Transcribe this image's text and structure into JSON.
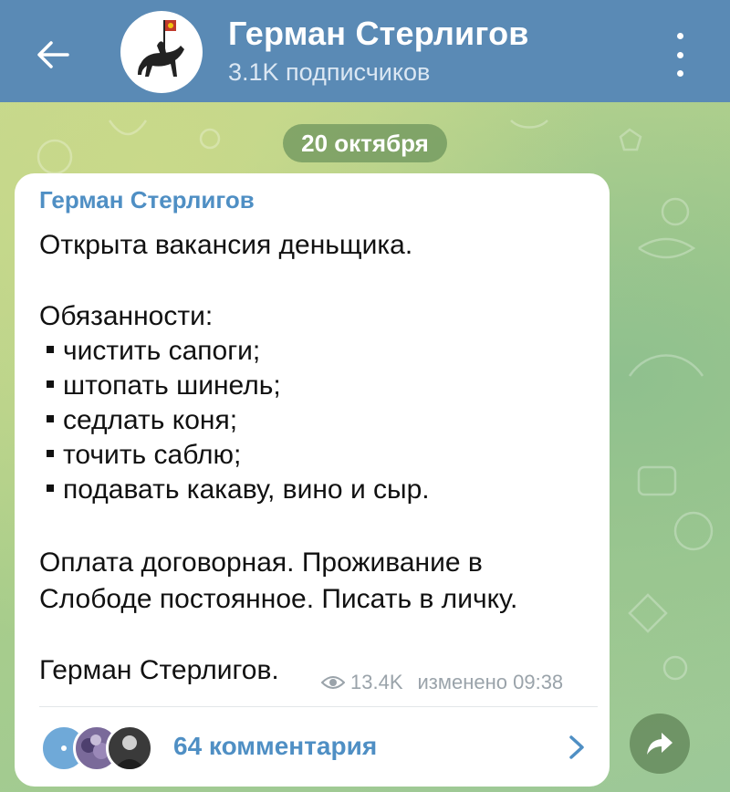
{
  "header": {
    "title": "Герман Стерлигов",
    "subtitle": "3.1K подписчиков"
  },
  "date_pill": "20 октября",
  "message": {
    "author": "Герман Стерлигов",
    "lines": {
      "l1": "Открыта вакансия деньщика.",
      "l2": "Обязанности:",
      "b1": "чистить сапоги;",
      "b2": "штопать шинель;",
      "b3": "седлать коня;",
      "b4": "точить саблю;",
      "b5": "подавать какаву, вино и сыр.",
      "l3": "Оплата договорная. Проживание в",
      "l4": "Слободе постоянное. Писать в личку.",
      "l5": "Герман Стерлигов."
    },
    "views": "13.4K",
    "edited": "изменено 09:38"
  },
  "comments": {
    "label": "64 комментария"
  },
  "icons": {
    "back": "arrow-left-icon",
    "menu": "more-vertical-icon",
    "views": "eye-icon",
    "chevron": "chevron-right-icon",
    "share": "share-icon"
  },
  "colors": {
    "header_bg": "#5a8ab5",
    "accent": "#4f8fc4",
    "chat_bg": "#a9c98a"
  }
}
